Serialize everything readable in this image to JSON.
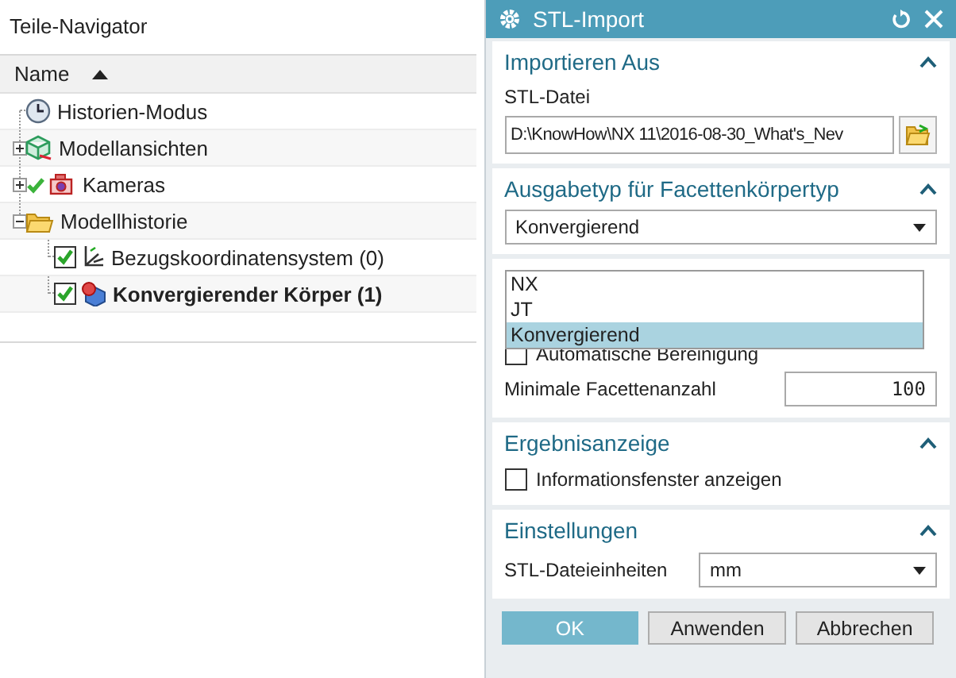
{
  "navigator": {
    "title": "Teile-Navigator",
    "column": {
      "label": "Name"
    },
    "tree": [
      {
        "label": "Historien-Modus",
        "kind": "history-mode"
      },
      {
        "label": "Modellansichten",
        "kind": "views",
        "expanded": false
      },
      {
        "label": "Kameras",
        "kind": "cameras",
        "expanded": false,
        "checked": true
      },
      {
        "label": "Modellhistorie",
        "kind": "folder",
        "expanded": true,
        "children": [
          {
            "label": "Bezugskoordinatensystem (0)",
            "kind": "csys",
            "checked": true,
            "active": false
          },
          {
            "label": "Konvergierender Körper (1)",
            "kind": "body",
            "checked": true,
            "active": true
          }
        ]
      }
    ]
  },
  "dialog": {
    "title": "STL-Import",
    "sections": [
      {
        "kind": "file",
        "title": "Importieren Aus",
        "expanded": true,
        "label": "STL-Datei",
        "value": "D:\\KnowHow\\NX 11\\2016-08-30_What's_Nev"
      },
      {
        "kind": "select",
        "title": "Ausgabetyp für Facettenkörpertyp",
        "expanded": true,
        "value": "Konvergierend",
        "open": true,
        "options": [
          {
            "label": "NX",
            "selected": false
          },
          {
            "label": "JT",
            "selected": false
          },
          {
            "label": "Konvergierend",
            "selected": true
          }
        ]
      },
      {
        "kind": "cleanup",
        "checkbox": {
          "label": "Automatische Bereinigung",
          "checked": false
        },
        "field_label": "Minimale Facettenanzahl",
        "field_value": "100"
      },
      {
        "kind": "checkbox",
        "title": "Ergebnisanzeige",
        "expanded": true,
        "checkbox": {
          "label": "Informationsfenster anzeigen",
          "checked": false
        }
      },
      {
        "kind": "units",
        "title": "Einstellungen",
        "expanded": true,
        "label": "STL-Dateieinheiten",
        "value": "mm"
      }
    ],
    "buttons": [
      {
        "label": "OK",
        "primary": true
      },
      {
        "label": "Anwenden",
        "primary": false
      },
      {
        "label": "Abbrechen",
        "primary": false
      }
    ]
  }
}
